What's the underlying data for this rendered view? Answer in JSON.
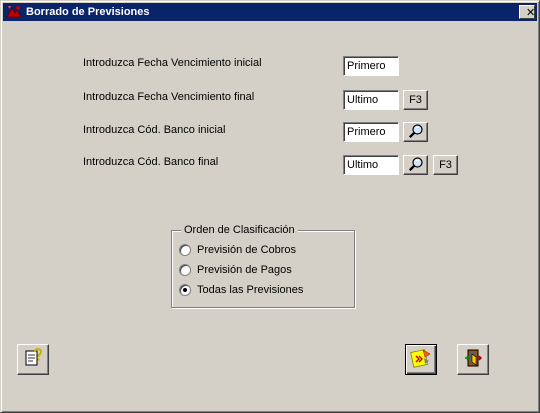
{
  "window": {
    "title": "Borrado de Previsiones",
    "close_glyph": "✕"
  },
  "form": {
    "fecha_inicial_label": "Introduzca Fecha Vencimiento inicial",
    "fecha_inicial_value": "Primero",
    "fecha_final_label": "Introduzca Fecha Vencimiento final",
    "fecha_final_value": "Ultimo",
    "banco_inicial_label": "Introduzca Cód. Banco inicial",
    "banco_inicial_value": "Primero",
    "banco_final_label": "Introduzca Cód. Banco final",
    "banco_final_value": "Ultimo",
    "f3_label": "F3"
  },
  "orden": {
    "legend": "Orden de Clasificación",
    "options": [
      {
        "label": "Previsión de Cobros",
        "checked": false
      },
      {
        "label": "Previsión de Pagos",
        "checked": false
      },
      {
        "label": "Todas las Previsiones",
        "checked": true
      }
    ]
  },
  "icons": {
    "app": "app-icon",
    "search": "magnifier-icon",
    "help": "help-document-icon",
    "execute": "execute-delete-icon",
    "exit": "exit-door-icon"
  },
  "colors": {
    "titlebar": "#0a246a",
    "face": "#d4d0c8"
  }
}
